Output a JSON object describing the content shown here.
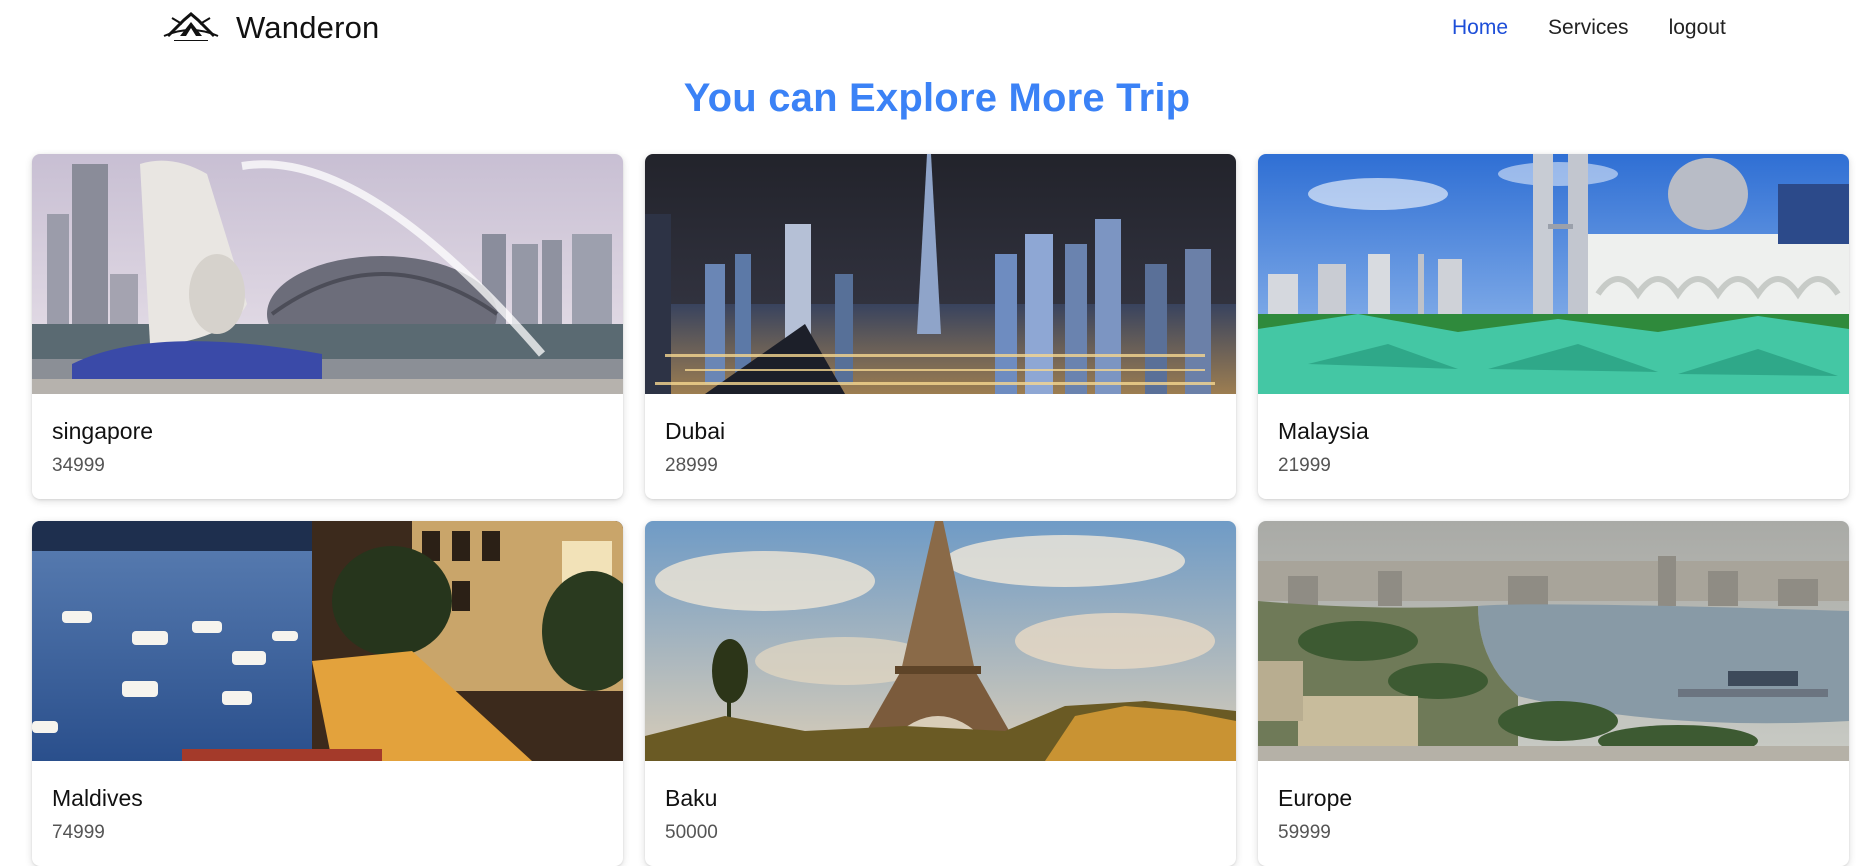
{
  "header": {
    "brand_name": "Wanderon",
    "logo_text": "WANDERON",
    "nav": [
      {
        "label": "Home",
        "active": true
      },
      {
        "label": "Services",
        "active": false
      },
      {
        "label": "logout",
        "active": false
      }
    ]
  },
  "main": {
    "title": "You can Explore More Trip",
    "cards": [
      {
        "title": "singapore",
        "price": "34999",
        "image": "singapore-merlion-photo"
      },
      {
        "title": "Dubai",
        "price": "28999",
        "image": "dubai-night-skyline-photo"
      },
      {
        "title": "Malaysia",
        "price": "21999",
        "image": "kuala-lumpur-skyline-photo"
      },
      {
        "title": "Maldives",
        "price": "74999",
        "image": "harbor-night-photo"
      },
      {
        "title": "Baku",
        "price": "50000",
        "image": "eiffel-tower-photo"
      },
      {
        "title": "Europe",
        "price": "59999",
        "image": "coastal-city-photo"
      }
    ]
  },
  "colors": {
    "title_blue": "#3b82f6",
    "nav_active": "#1d4ed8"
  }
}
